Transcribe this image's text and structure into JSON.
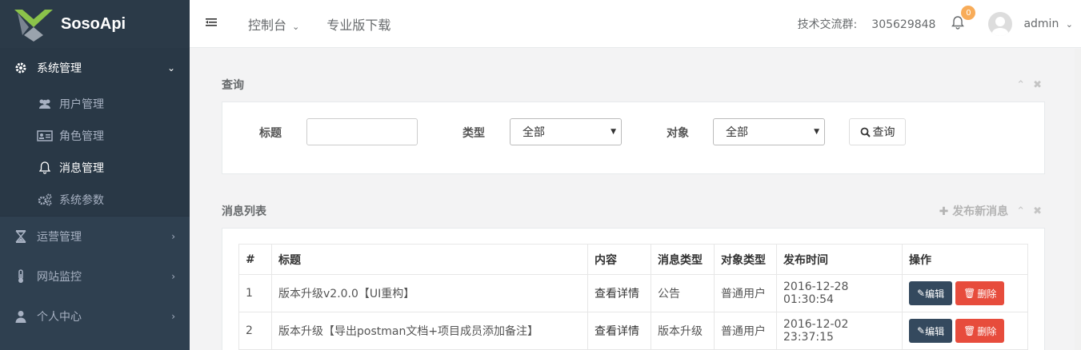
{
  "app": {
    "name": "SosoApi"
  },
  "sidebar": {
    "system": {
      "label": "系统管理",
      "icon": "gear-icon"
    },
    "sub_items": [
      {
        "label": "用户管理",
        "icon": "users-icon"
      },
      {
        "label": "角色管理",
        "icon": "id-card-icon"
      },
      {
        "label": "消息管理",
        "icon": "bell-icon"
      },
      {
        "label": "系统参数",
        "icon": "cogs-icon"
      }
    ],
    "items": [
      {
        "label": "运营管理",
        "icon": "hourglass-icon"
      },
      {
        "label": "网站监控",
        "icon": "thermometer-icon"
      },
      {
        "label": "个人中心",
        "icon": "user-icon"
      }
    ]
  },
  "topbar": {
    "console": "控制台",
    "download": "专业版下载",
    "group_label": "技术交流群:",
    "group_number": "305629848",
    "notifications": "0",
    "username": "admin"
  },
  "query_panel": {
    "title": "查询",
    "title_label": "标题",
    "title_value": "",
    "type_label": "类型",
    "type_value": "全部",
    "target_label": "对象",
    "target_value": "全部",
    "search_button": "查询"
  },
  "list_panel": {
    "title": "消息列表",
    "publish": "发布新消息",
    "headers": [
      "#",
      "标题",
      "内容",
      "消息类型",
      "对象类型",
      "发布时间",
      "操作"
    ],
    "rows": [
      {
        "id": "1",
        "title": "版本升级v2.0.0【UI重构】",
        "content": "查看详情",
        "msg_type": "公告",
        "target": "普通用户",
        "time": "2016-12-28 01:30:54"
      },
      {
        "id": "2",
        "title": "版本升级【导出postman文档+项目成员添加备注】",
        "content": "查看详情",
        "msg_type": "版本升级",
        "target": "普通用户",
        "time": "2016-12-02 23:37:15"
      }
    ],
    "edit": "编辑",
    "delete": "删除"
  }
}
